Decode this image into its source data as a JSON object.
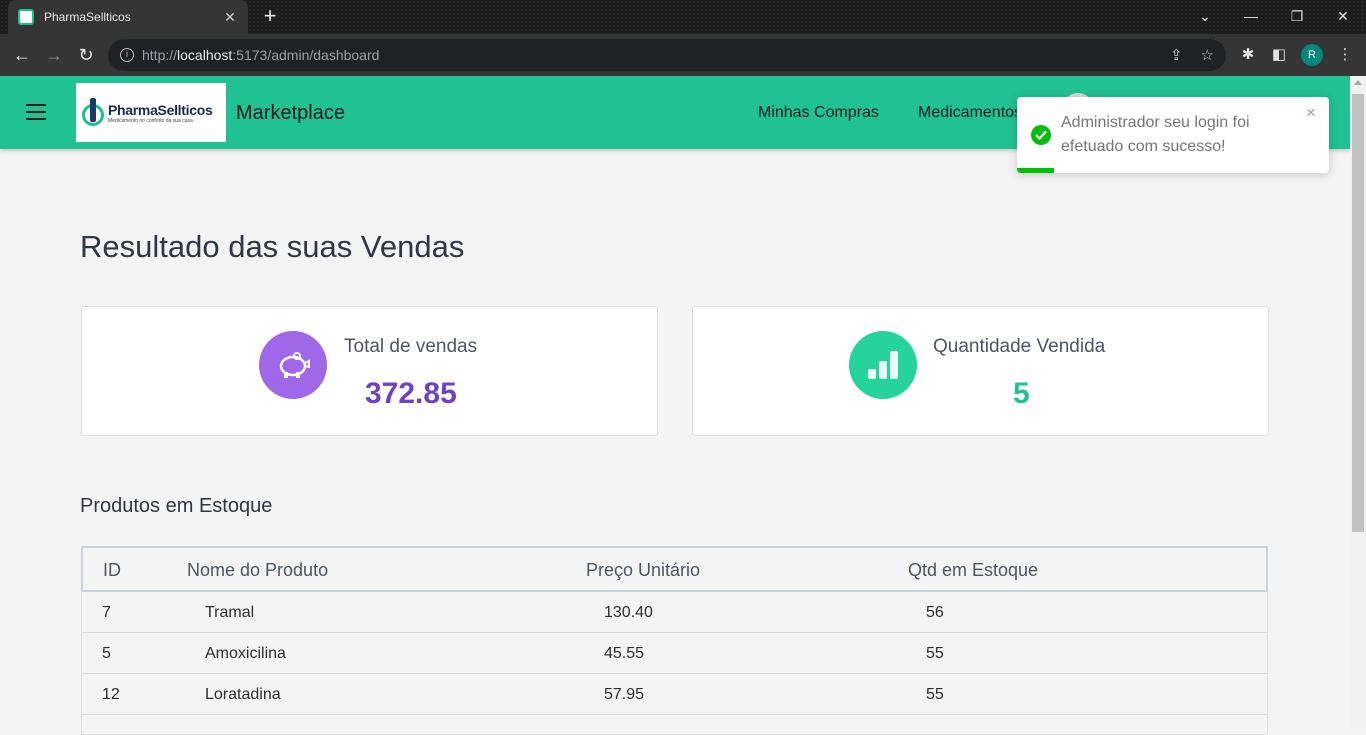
{
  "browser": {
    "tab_title": "PharmaSellticos",
    "tab_close": "✕",
    "new_tab": "+",
    "url_prefix": "http://",
    "url_host": "localhost",
    "url_rest": ":5173/admin/dashboard",
    "profile_initial": "R"
  },
  "header": {
    "logo_name": "PharmaSellticos",
    "logo_tagline": "Medicamento no conforto da sua casa",
    "brand": "Marketplace",
    "nav": [
      "Minhas Compras",
      "Medicamentos"
    ]
  },
  "main": {
    "title": "Resultado das suas Vendas",
    "cards": [
      {
        "label": "Total de vendas",
        "value": "372.85",
        "color": "#6f42c1",
        "icon_bg": "#9f68e8",
        "icon": "piggy-bank-icon"
      },
      {
        "label": "Quantidade Vendida",
        "value": "5",
        "color": "#20c192",
        "icon_bg": "#26d39b",
        "icon": "bar-chart-icon"
      }
    ],
    "stock_title": "Produtos em Estoque",
    "table": {
      "headers": [
        "ID",
        "Nome do Produto",
        "Preço Unitário",
        "Qtd em Estoque"
      ],
      "rows": [
        [
          "7",
          "Tramal",
          "130.40",
          "56"
        ],
        [
          "5",
          "Amoxicilina",
          "45.55",
          "55"
        ],
        [
          "12",
          "Loratadina",
          "57.95",
          "55"
        ]
      ]
    }
  },
  "toast": {
    "message": "Administrador seu login foi efetuado com sucesso!",
    "close": "×",
    "progress": 0.12
  },
  "colors": {
    "header_bg": "#20c192",
    "accent_purple": "#6f42c1",
    "accent_green": "#20c192",
    "success": "#07bc0c"
  }
}
